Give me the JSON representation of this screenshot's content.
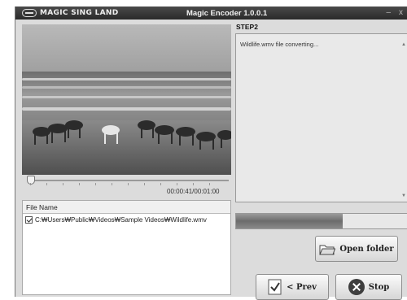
{
  "window": {
    "brand": "MAGIC SING LAND",
    "title": "Magic Encoder 1.0.0.1",
    "controls": [
      "–",
      "x"
    ]
  },
  "player": {
    "timecode": "00:00:41/00:01:00",
    "position": 0.02
  },
  "file_list": {
    "header": "File Name",
    "items": [
      {
        "checked": true,
        "path": "C:₩Users₩Public₩Videos₩Sample Videos₩Wildlife.wmv"
      }
    ]
  },
  "step": {
    "label": "STEP2",
    "log": "Wildlife.wmv file converting..."
  },
  "progress": {
    "fraction": 0.62
  },
  "buttons": {
    "open_folder": "Open folder",
    "prev": "< Prev",
    "stop": "Stop"
  },
  "icons": {
    "brand": "brand-logo-icon",
    "open_folder": "folder-icon",
    "prev": "document-check-icon",
    "stop": "stop-x-circle-icon"
  }
}
